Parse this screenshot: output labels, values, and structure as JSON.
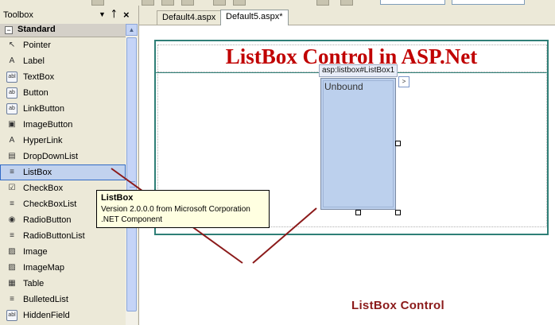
{
  "toolbox": {
    "title": "Toolbox",
    "group": "Standard",
    "items": [
      {
        "label": "Pointer",
        "icon": "pointer-icon",
        "glyph": "↖"
      },
      {
        "label": "Label",
        "icon": "label-icon",
        "glyph": "A"
      },
      {
        "label": "TextBox",
        "icon": "textbox-icon",
        "glyph": "abl"
      },
      {
        "label": "Button",
        "icon": "button-icon",
        "glyph": "ab"
      },
      {
        "label": "LinkButton",
        "icon": "linkbutton-icon",
        "glyph": "ab"
      },
      {
        "label": "ImageButton",
        "icon": "imagebutton-icon",
        "glyph": "▣"
      },
      {
        "label": "HyperLink",
        "icon": "hyperlink-icon",
        "glyph": "A"
      },
      {
        "label": "DropDownList",
        "icon": "dropdownlist-icon",
        "glyph": "▤"
      },
      {
        "label": "ListBox",
        "icon": "listbox-icon",
        "glyph": "≡"
      },
      {
        "label": "CheckBox",
        "icon": "checkbox-icon",
        "glyph": "☑"
      },
      {
        "label": "CheckBoxList",
        "icon": "checkboxlist-icon",
        "glyph": "≡"
      },
      {
        "label": "RadioButton",
        "icon": "radiobutton-icon",
        "glyph": "◉"
      },
      {
        "label": "RadioButtonList",
        "icon": "radiobuttonlist-icon",
        "glyph": "≡"
      },
      {
        "label": "Image",
        "icon": "image-icon",
        "glyph": "▨"
      },
      {
        "label": "ImageMap",
        "icon": "imagemap-icon",
        "glyph": "▨"
      },
      {
        "label": "Table",
        "icon": "table-icon",
        "glyph": "▦"
      },
      {
        "label": "BulletedList",
        "icon": "bulletedlist-icon",
        "glyph": "≡"
      },
      {
        "label": "HiddenField",
        "icon": "hiddenfield-icon",
        "glyph": "abl"
      }
    ],
    "selected_index": 8
  },
  "tabs": [
    {
      "label": "Default4.aspx"
    },
    {
      "label": "Default5.aspx*"
    }
  ],
  "design": {
    "page_title": "ListBox Control in ASP.Net",
    "listbox_tag": "asp:listbox#ListBox1",
    "listbox_item": "Unbound",
    "smart_tag_glyph": ">",
    "annotation": "ListBox Control"
  },
  "tooltip": {
    "title": "ListBox",
    "line1": "Version 2.0.0.0 from Microsoft Corporation",
    "line2": ".NET Component"
  },
  "colors": {
    "title_red": "#c00000",
    "frame_teal": "#2f7f77",
    "annotation_line": "#8b1a1a",
    "selection_blue": "#c1d2ee"
  }
}
